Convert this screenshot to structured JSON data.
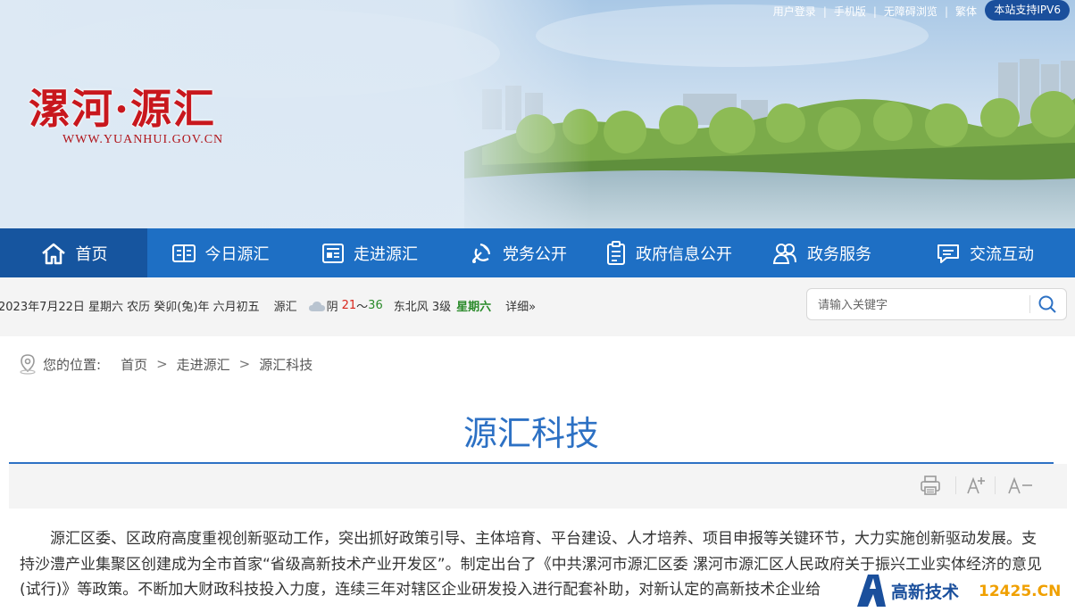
{
  "top_links": [
    "用户登录",
    "手机版",
    "无障碍浏览",
    "繁体"
  ],
  "ipv6_badge": "本站支持IPV6",
  "logo": {
    "title": "漯河·源汇",
    "url": "WWW.YUANHUI.GOV.CN"
  },
  "nav": [
    {
      "label": "首页",
      "icon": "home-icon",
      "active": true
    },
    {
      "label": "今日源汇",
      "icon": "book-icon"
    },
    {
      "label": "走进源汇",
      "icon": "newspaper-icon"
    },
    {
      "label": "党务公开",
      "icon": "party-emblem-icon"
    },
    {
      "label": "政府信息公开",
      "icon": "document-list-icon"
    },
    {
      "label": "政务服务",
      "icon": "people-icon"
    },
    {
      "label": "交流互动",
      "icon": "chat-icon"
    }
  ],
  "info": {
    "date": "2023年7月22日 星期六 农历 癸卯(兔)年 六月初五",
    "city": "源汇",
    "weather": "阴",
    "temp_high": "21",
    "temp_sep": "～",
    "temp_low": "36",
    "wind": "东北风 3级",
    "weekday": "星期六",
    "detail": "详细»"
  },
  "search": {
    "placeholder": "请输入关键字"
  },
  "breadcrumb": {
    "label": "您的位置:",
    "items": [
      "首页",
      "走进源汇",
      "源汇科技"
    ],
    "separator": ">"
  },
  "article": {
    "title": "源汇科技",
    "body": "源汇区委、区政府高度重视创新驱动工作，突出抓好政策引导、主体培育、平台建设、人才培养、项目申报等关键环节，大力实施创新驱动发展。支持沙澧产业集聚区创建成为全市首家“省级高新技术产业开发区”。制定出台了《中共漯河市源汇区委 漯河市源汇区人民政府关于振兴工业实体经济的意见(试行)》等政策。不断加大财政科技投入力度，连续三年对辖区企业研发投入进行配套补助，对新认定的高新技术企业给"
  },
  "tools": [
    "print-icon",
    "font-increase-icon",
    "font-decrease-icon"
  ],
  "watermark": {
    "brand": "高新技术",
    "site": "12425.CN"
  },
  "colors": {
    "nav": "#1e6fc4",
    "nav_active": "#16559f",
    "logo_red": "#c8171d",
    "title_blue": "#2d71c4"
  }
}
